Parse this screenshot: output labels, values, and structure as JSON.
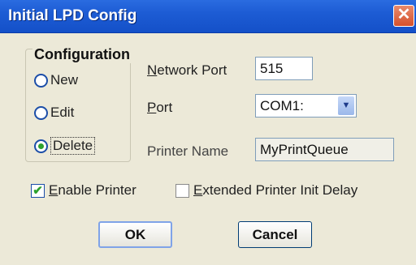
{
  "window": {
    "title": "Initial LPD Config",
    "close_glyph": "✕"
  },
  "configuration": {
    "title": "Configuration",
    "options": [
      {
        "label": "New",
        "selected": false
      },
      {
        "label": "Edit",
        "selected": false
      },
      {
        "label": "Delete",
        "selected": true
      }
    ]
  },
  "fields": {
    "network_port": {
      "label_prefix": "N",
      "label_rest": "etwork Port",
      "value": "515"
    },
    "port": {
      "label_prefix": "P",
      "label_rest": "ort",
      "value": "COM1:"
    },
    "printer_name": {
      "label": "Printer Name",
      "value": "MyPrintQueue"
    }
  },
  "checkboxes": {
    "enable_printer": {
      "label_prefix": "E",
      "label_rest": "nable Printer",
      "checked": true
    },
    "extended_delay": {
      "label_prefix": "E",
      "label_rest": "xtended Printer Init Delay",
      "checked": false
    }
  },
  "buttons": {
    "ok": "OK",
    "cancel": "Cancel"
  },
  "colors": {
    "title_bar": "#1d5cd4",
    "dialog_bg": "#ece9d8",
    "close_button": "#d5512c",
    "check_green": "#2ea12e"
  }
}
